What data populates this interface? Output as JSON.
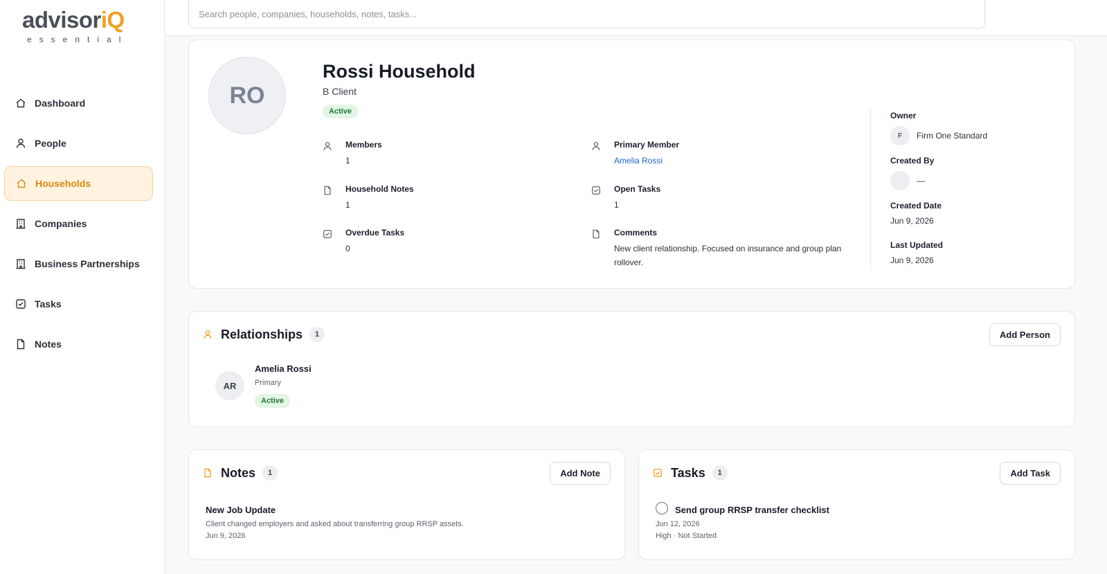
{
  "brand": {
    "name": "advisor",
    "accent": "iQ",
    "tagline": "essential",
    "color": "#f0a020"
  },
  "search": {
    "placeholder": "Search people, companies, households, notes, tasks..."
  },
  "nav": {
    "dashboard": "Dashboard",
    "people": "People",
    "households": "Households",
    "companies": "Companies",
    "business_partnerships": "Business Partnerships",
    "tasks": "Tasks",
    "notes": "Notes"
  },
  "household": {
    "initials": "RO",
    "name": "Rossi Household",
    "tier": "B Client",
    "status": "Active",
    "fields": {
      "members_label": "Members",
      "members_value": "1",
      "primary_label": "Primary Member",
      "primary_value": "Amelia Rossi",
      "notes_label": "Household Notes",
      "notes_value": "1",
      "open_tasks_label": "Open Tasks",
      "open_tasks_value": "1",
      "overdue_label": "Overdue Tasks",
      "overdue_value": "0",
      "comments_label": "Comments",
      "comments_value": "New client relationship. Focused on insurance and group plan rollover."
    },
    "meta": {
      "owner_label": "Owner",
      "owner_initial": "F",
      "owner_value": "Firm One Standard",
      "created_by_label": "Created By",
      "created_by_value": "—",
      "created_date_label": "Created Date",
      "created_date_value": "Jun 9, 2026",
      "updated_label": "Last Updated",
      "updated_value": "Jun 9, 2026"
    }
  },
  "relationships": {
    "title": "Relationships",
    "count": "1",
    "add_label": "Add Person",
    "items": [
      {
        "initials": "AR",
        "name": "Amelia Rossi",
        "role": "Primary",
        "status": "Active"
      }
    ]
  },
  "notes": {
    "title": "Notes",
    "count": "1",
    "add_label": "Add Note",
    "items": [
      {
        "title": "New Job Update",
        "body": "Client changed employers and asked about transferring group RRSP assets.",
        "date": "Jun 9, 2026"
      }
    ]
  },
  "tasks": {
    "title": "Tasks",
    "count": "1",
    "add_label": "Add Task",
    "items": [
      {
        "title": "Send group RRSP transfer checklist",
        "due": "Jun 12, 2026",
        "detail": "High · Not Started"
      }
    ]
  }
}
